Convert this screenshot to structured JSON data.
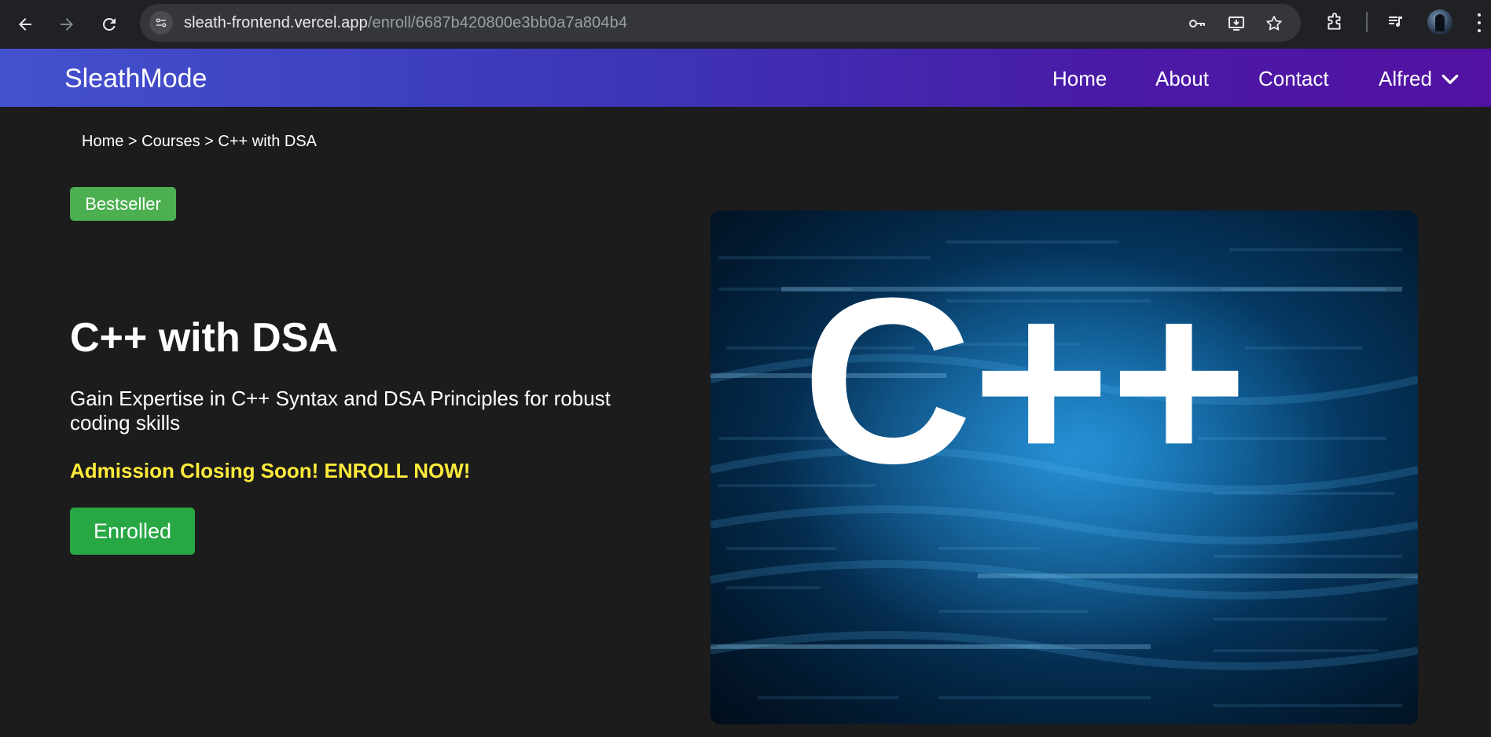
{
  "browser": {
    "url_host": "sleath-frontend.vercel.app",
    "url_path": "/enroll/6687b420800e3bb0a7a804b4"
  },
  "navbar": {
    "brand": "SleathMode",
    "links": [
      "Home",
      "About",
      "Contact"
    ],
    "user_name": "Alfred"
  },
  "breadcrumb": "Home > Courses > C++ with DSA",
  "course": {
    "badge": "Bestseller",
    "title": "C++ with DSA",
    "description": "Gain Expertise in C++ Syntax and DSA Principles for robust coding skills",
    "admission_notice": "Admission Closing Soon! ENROLL NOW!",
    "enroll_button": "Enrolled",
    "image_logo_text": "C++"
  },
  "colors": {
    "badge_green": "#4caf50",
    "button_green": "#28a745",
    "notice_yellow": "#ffeb3b",
    "navbar_start": "#4451cf",
    "navbar_end": "#5211a2",
    "page_bg": "#1c1c1c"
  },
  "icons": [
    "back-icon",
    "forward-icon",
    "reload-icon",
    "site-info-icon",
    "password-key-icon",
    "install-app-icon",
    "bookmark-star-icon",
    "extensions-icon",
    "media-controls-icon",
    "chrome-menu-icon",
    "chevron-down-icon"
  ]
}
